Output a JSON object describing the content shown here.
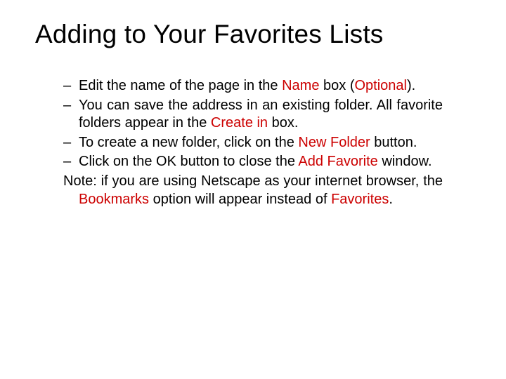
{
  "title": "Adding to Your Favorites Lists",
  "bullets": [
    {
      "pre": "Edit the name of the page in the ",
      "hl1": "Name",
      "mid1": " box (",
      "hl2": "Optional",
      "post": ")."
    },
    {
      "pre": "You can save the address in an existing folder. All favorite folders appear in the ",
      "hl1": "Create in",
      "post": " box."
    },
    {
      "pre": "To create a new folder, click on the ",
      "hl1": "New Folder",
      "post": " button."
    },
    {
      "pre": "Click on the OK button to close the ",
      "hl1": "Add Favorite",
      "post": " window."
    }
  ],
  "note": {
    "pre": "Note: if you are using Netscape as your internet browser, the ",
    "hl1": "Bookmarks",
    "mid1": " option will appear instead of ",
    "hl2": "Favorites",
    "post": "."
  },
  "dash": "–"
}
